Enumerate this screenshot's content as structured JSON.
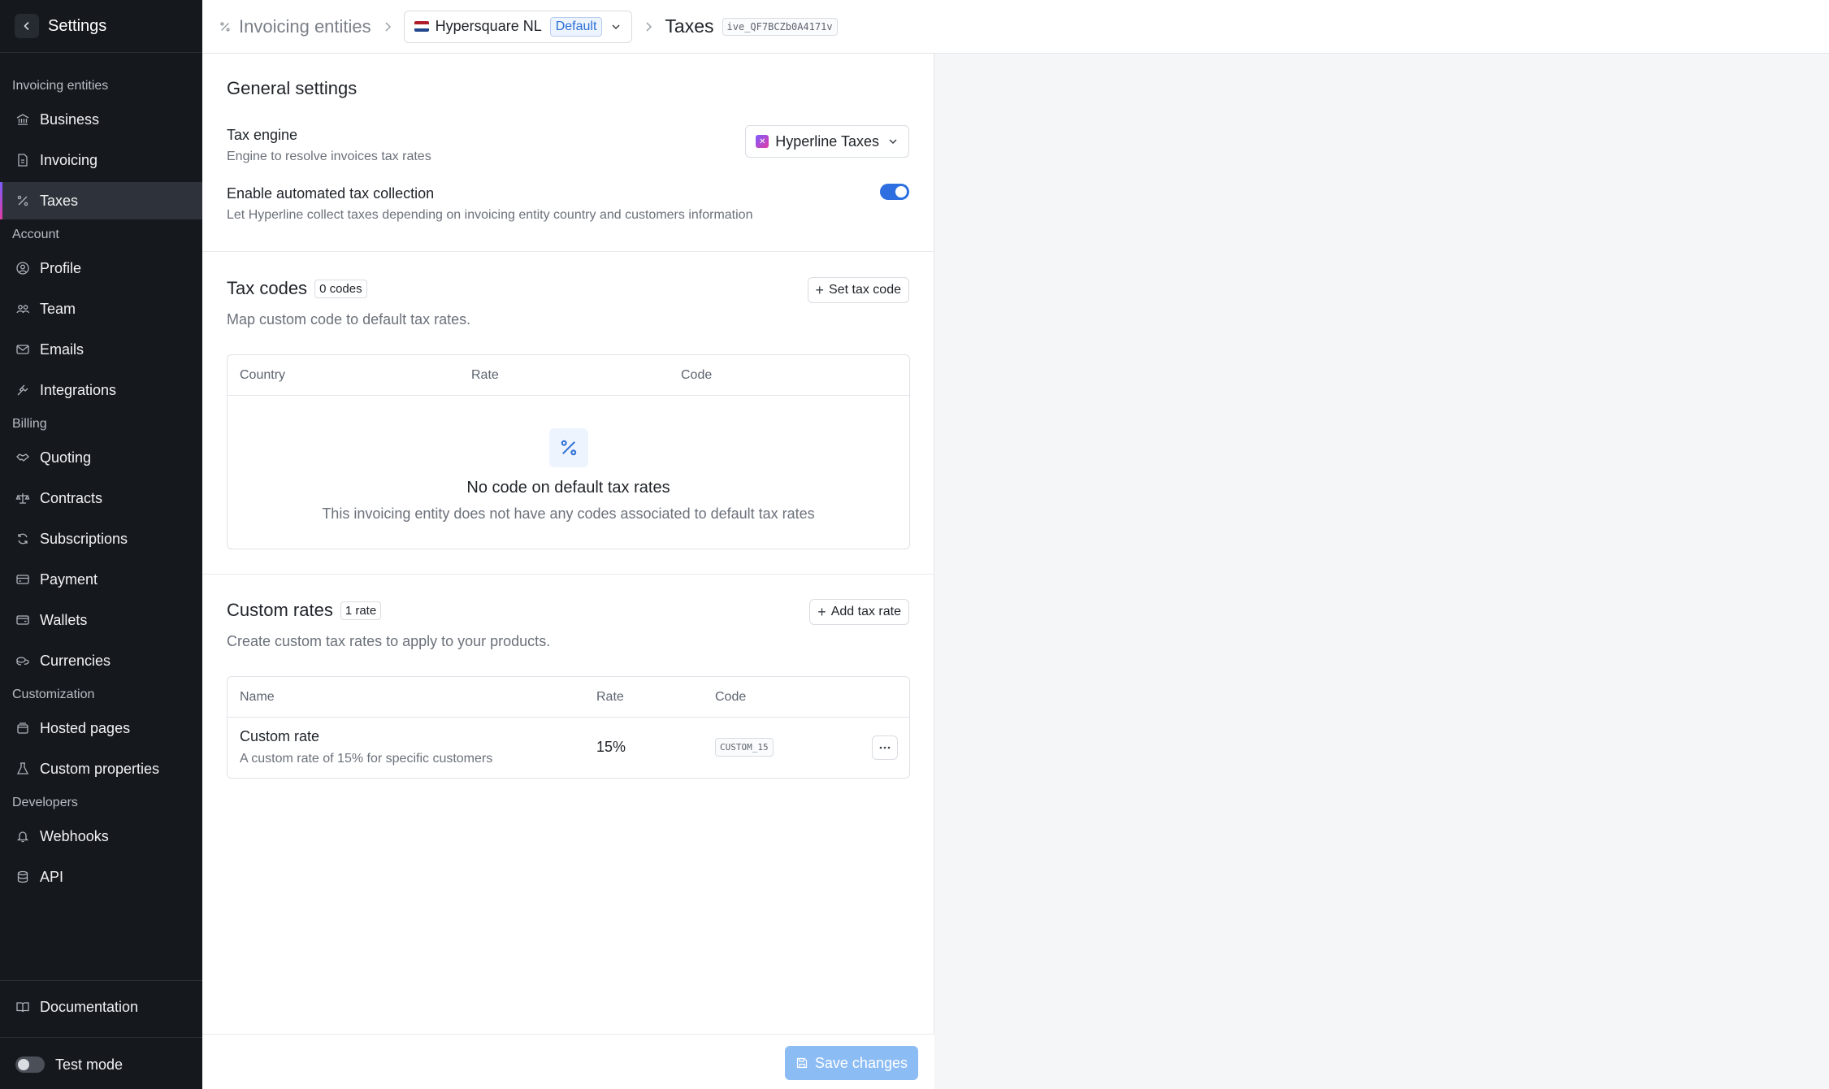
{
  "sidebar": {
    "title": "Settings",
    "sections": [
      {
        "label": "Invoicing entities",
        "items": [
          {
            "label": "Business",
            "icon": "bank-icon"
          },
          {
            "label": "Invoicing",
            "icon": "document-icon"
          },
          {
            "label": "Taxes",
            "icon": "percent-icon",
            "active": true
          }
        ]
      },
      {
        "label": "Account",
        "items": [
          {
            "label": "Profile",
            "icon": "user-circle-icon"
          },
          {
            "label": "Team",
            "icon": "team-icon"
          },
          {
            "label": "Emails",
            "icon": "mail-icon"
          },
          {
            "label": "Integrations",
            "icon": "plug-icon"
          }
        ]
      },
      {
        "label": "Billing",
        "items": [
          {
            "label": "Quoting",
            "icon": "handshake-icon"
          },
          {
            "label": "Contracts",
            "icon": "scale-icon"
          },
          {
            "label": "Subscriptions",
            "icon": "refresh-icon"
          },
          {
            "label": "Payment",
            "icon": "card-icon"
          },
          {
            "label": "Wallets",
            "icon": "wallet-icon"
          },
          {
            "label": "Currencies",
            "icon": "coins-icon"
          }
        ]
      },
      {
        "label": "Customization",
        "items": [
          {
            "label": "Hosted pages",
            "icon": "pages-icon"
          },
          {
            "label": "Custom properties",
            "icon": "flask-icon"
          }
        ]
      },
      {
        "label": "Developers",
        "items": [
          {
            "label": "Webhooks",
            "icon": "bell-icon"
          },
          {
            "label": "API",
            "icon": "database-icon"
          }
        ]
      }
    ],
    "documentation": "Documentation",
    "test_mode": "Test mode"
  },
  "topbar": {
    "crumb_root": "Invoicing entities",
    "entity_name": "Hypersquare NL",
    "entity_badge": "Default",
    "current": "Taxes",
    "entity_id": "ive_QF7BCZb0A4171v"
  },
  "general": {
    "title": "General settings",
    "tax_engine_label": "Tax engine",
    "tax_engine_sub": "Engine to resolve invoices tax rates",
    "tax_engine_value": "Hyperline Taxes",
    "auto_label": "Enable automated tax collection",
    "auto_sub": "Let Hyperline collect taxes depending on invoicing entity country and customers information",
    "auto_enabled": true
  },
  "tax_codes": {
    "title": "Tax codes",
    "count": "0 codes",
    "button": "Set tax code",
    "sub": "Map custom code to default tax rates.",
    "columns": [
      "Country",
      "Rate",
      "Code"
    ],
    "empty_title": "No code on default tax rates",
    "empty_sub": "This invoicing entity does not have any codes associated to default tax rates"
  },
  "custom_rates": {
    "title": "Custom rates",
    "count": "1 rate",
    "button": "Add tax rate",
    "sub": "Create custom tax rates to apply to your products.",
    "columns": [
      "Name",
      "Rate",
      "Code"
    ],
    "rows": [
      {
        "name": "Custom rate",
        "description": "A custom rate of 15% for specific customers",
        "rate": "15%",
        "code": "CUSTOM_15"
      }
    ]
  },
  "footer": {
    "save": "Save changes"
  },
  "colors": {
    "accent": "#2d6fe0",
    "sidebar_bg": "#15181d",
    "save_disabled": "#8cbcf4"
  }
}
